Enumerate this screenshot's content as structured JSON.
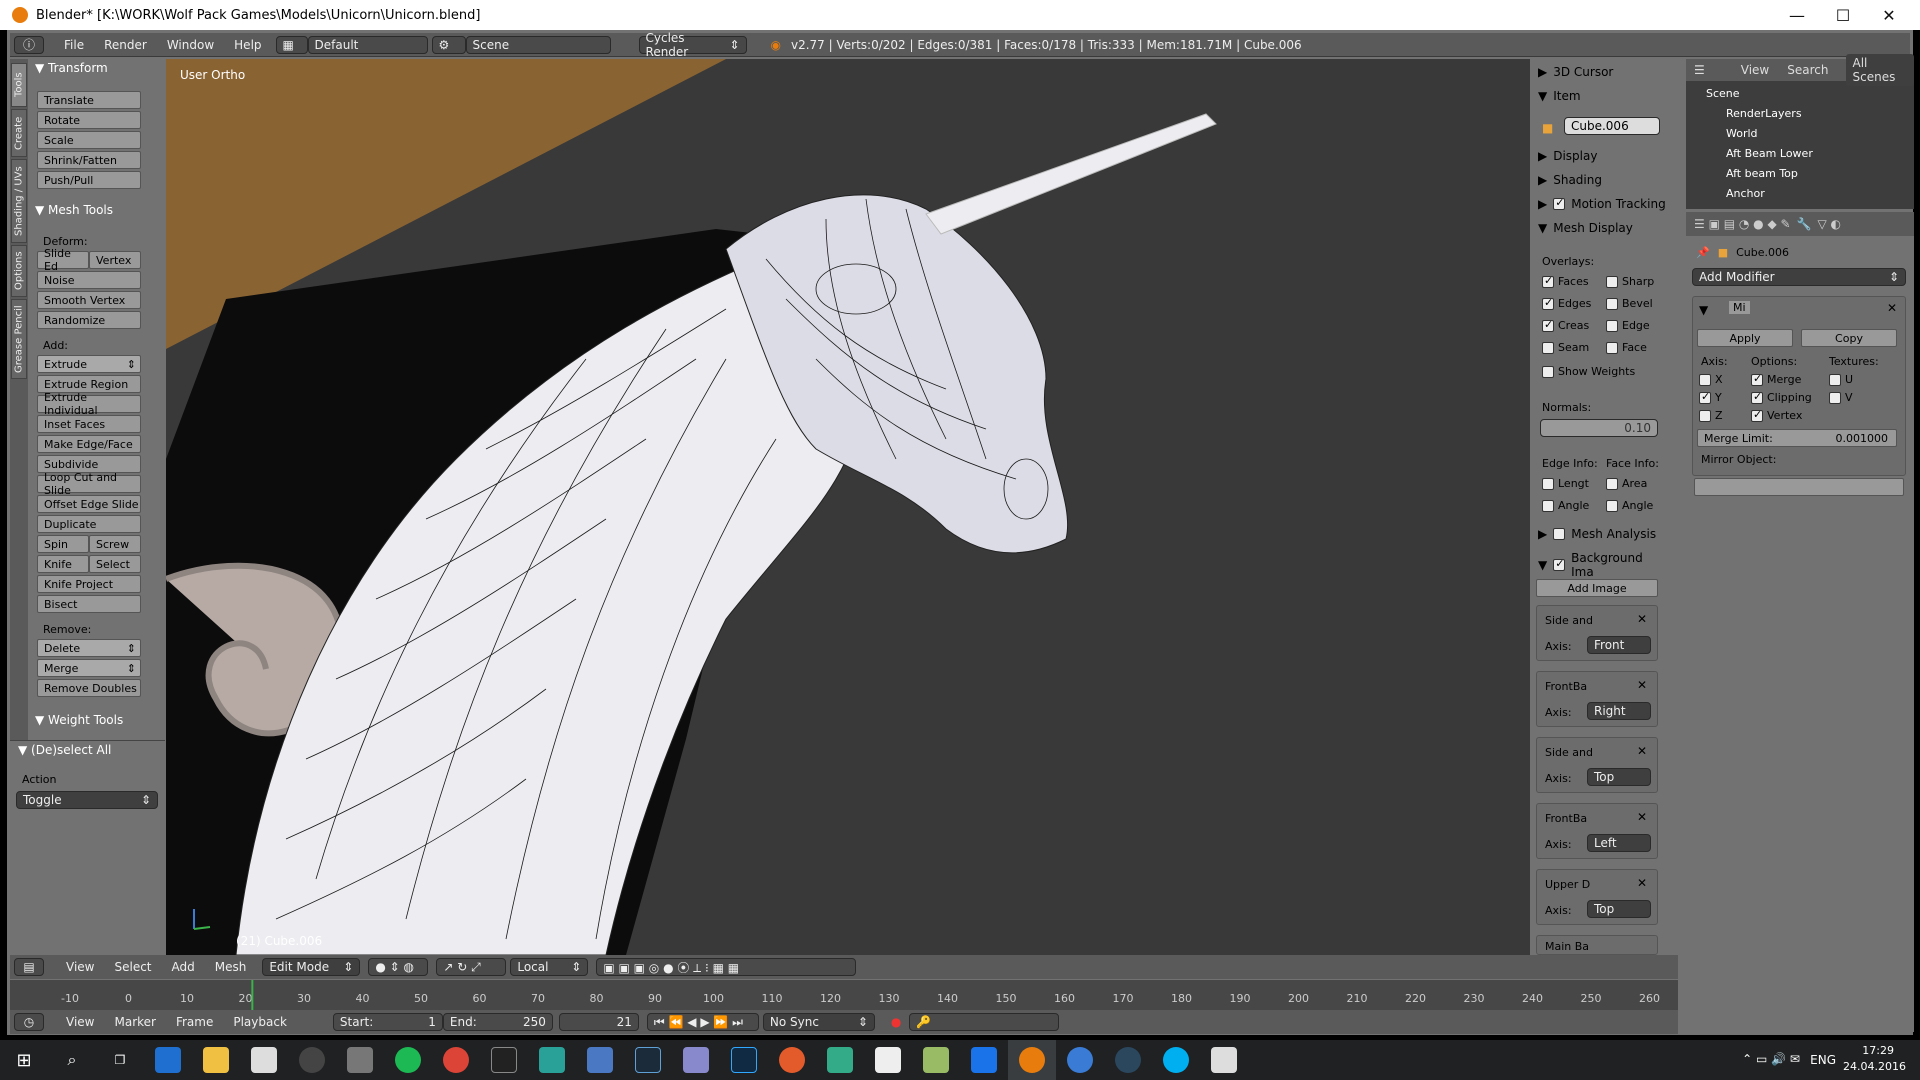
{
  "window": {
    "title": "Blender* [K:\\WORK\\Wolf Pack Games\\Models\\Unicorn\\Unicorn.blend]",
    "minimize": "—",
    "maximize": "☐",
    "close": "✕"
  },
  "info": {
    "menus": [
      "File",
      "Render",
      "Window",
      "Help"
    ],
    "layout": "Default",
    "scene": "Scene",
    "engine": "Cycles Render",
    "stats": "v2.77 | Verts:0/202 | Edges:0/381 | Faces:0/178 | Tris:333 | Mem:181.71M | Cube.006"
  },
  "tabs": [
    "Tools",
    "Create",
    "Shading / UVs",
    "Options",
    "Grease Pencil"
  ],
  "toolshelf": {
    "transform": "Transform",
    "transform_btns": [
      "Translate",
      "Rotate",
      "Scale",
      "Shrink/Fatten",
      "Push/Pull"
    ],
    "mesh_tools": "Mesh Tools",
    "deform": "Deform:",
    "slide_ed": "Slide Ed",
    "vertex": "Vertex",
    "deform_btns": [
      "Noise",
      "Smooth Vertex",
      "Randomize"
    ],
    "add": "Add:",
    "extrude": "Extrude",
    "add_btns": [
      "Extrude Region",
      "Extrude Individual",
      "Inset Faces",
      "Make Edge/Face",
      "Subdivide",
      "Loop Cut and Slide",
      "Offset Edge Slide",
      "Duplicate"
    ],
    "spin": "Spin",
    "screw": "Screw",
    "knife": "Knife",
    "select": "Select",
    "more_btns": [
      "Knife Project",
      "Bisect"
    ],
    "remove": "Remove:",
    "delete": "Delete",
    "merge": "Merge",
    "remove_doubles": "Remove Doubles",
    "weight_tools": "Weight Tools"
  },
  "operator": {
    "title": "(De)select All",
    "action_label": "Action",
    "action_value": "Toggle"
  },
  "viewport": {
    "view_name": "User Ortho",
    "object_label": "(21) Cube.006"
  },
  "npanel": {
    "cursor": "3D Cursor",
    "item": "Item",
    "item_name": "Cube.006",
    "display": "Display",
    "shading": "Shading",
    "motion": "Motion Tracking",
    "mesh_display": "Mesh Display",
    "overlays": "Overlays:",
    "ov_left": [
      {
        "label": "Faces",
        "on": true
      },
      {
        "label": "Edges",
        "on": true
      },
      {
        "label": "Creas",
        "on": true
      },
      {
        "label": "Seam",
        "on": false
      }
    ],
    "ov_right": [
      {
        "label": "Sharp",
        "on": false
      },
      {
        "label": "Bevel",
        "on": false
      },
      {
        "label": "Edge",
        "on": false
      },
      {
        "label": "Face",
        "on": false
      }
    ],
    "show_weights": "Show Weights",
    "normals": "Normals:",
    "normal_size": "0.10",
    "edge_info": "Edge Info:",
    "face_info": "Face Info:",
    "edge_items": [
      "Lengt",
      "Angle"
    ],
    "face_items": [
      "Area",
      "Angle"
    ],
    "mesh_analysis": "Mesh Analysis",
    "bg_images": "Background Ima",
    "add_image": "Add Image",
    "axis_label": "Axis:",
    "bg_list": [
      {
        "name": "Side and",
        "axis": "Front"
      },
      {
        "name": "FrontBa",
        "axis": "Right"
      },
      {
        "name": "Side and",
        "axis": "Top"
      },
      {
        "name": "FrontBa",
        "axis": "Left"
      },
      {
        "name": "Upper D",
        "axis": "Top"
      }
    ],
    "bg_partial": "Main Ba"
  },
  "outliner": {
    "menus": [
      "View",
      "Search"
    ],
    "filter": "All Scenes",
    "items": [
      {
        "label": "Scene",
        "depth": 0
      },
      {
        "label": "RenderLayers",
        "depth": 1
      },
      {
        "label": "World",
        "depth": 1
      },
      {
        "label": "Aft Beam Lower",
        "depth": 1
      },
      {
        "label": "Aft beam Top",
        "depth": 1
      },
      {
        "label": "Anchor",
        "depth": 1
      }
    ]
  },
  "properties": {
    "object": "Cube.006",
    "add_modifier": "Add Modifier",
    "mod_name": "Mi",
    "apply": "Apply",
    "copy": "Copy",
    "axis": "Axis:",
    "options": "Options:",
    "textures": "Textures:",
    "axes": [
      {
        "label": "X",
        "on": false
      },
      {
        "label": "Y",
        "on": true
      },
      {
        "label": "Z",
        "on": false
      }
    ],
    "opts": [
      {
        "label": "Merge",
        "on": true
      },
      {
        "label": "Clipping",
        "on": true
      },
      {
        "label": "Vertex",
        "on": true
      }
    ],
    "tex": [
      {
        "label": "U",
        "on": false
      },
      {
        "label": "V",
        "on": false
      }
    ],
    "merge_limit_label": "Merge Limit:",
    "merge_limit": "0.001000",
    "mirror_object": "Mirror Object:"
  },
  "vphead": {
    "menus": [
      "View",
      "Select",
      "Add",
      "Mesh"
    ],
    "mode": "Edit Mode",
    "pivot": "Local"
  },
  "timeline": {
    "ticks": [
      "-10",
      "0",
      "10",
      "20",
      "30",
      "40",
      "50",
      "60",
      "70",
      "80",
      "90",
      "100",
      "110",
      "120",
      "130",
      "140",
      "150",
      "160",
      "170",
      "180",
      "190",
      "200",
      "210",
      "220",
      "230",
      "240",
      "250",
      "260"
    ],
    "current": 21
  },
  "tlhead": {
    "menus": [
      "View",
      "Marker",
      "Frame",
      "Playback"
    ],
    "start_label": "Start:",
    "start": "1",
    "end_label": "End:",
    "end": "250",
    "current": "21",
    "sync": "No Sync"
  },
  "taskbar": {
    "lang": "ENG",
    "time": "17:29",
    "date": "24.04.2016"
  },
  "colors": {
    "bg_viewport": "#393939",
    "panel": "#727272",
    "header": "#5a5a5a",
    "blender_orange": "#e87d0d",
    "mesh": "#e9e9ef",
    "wood": "#8a6332"
  }
}
